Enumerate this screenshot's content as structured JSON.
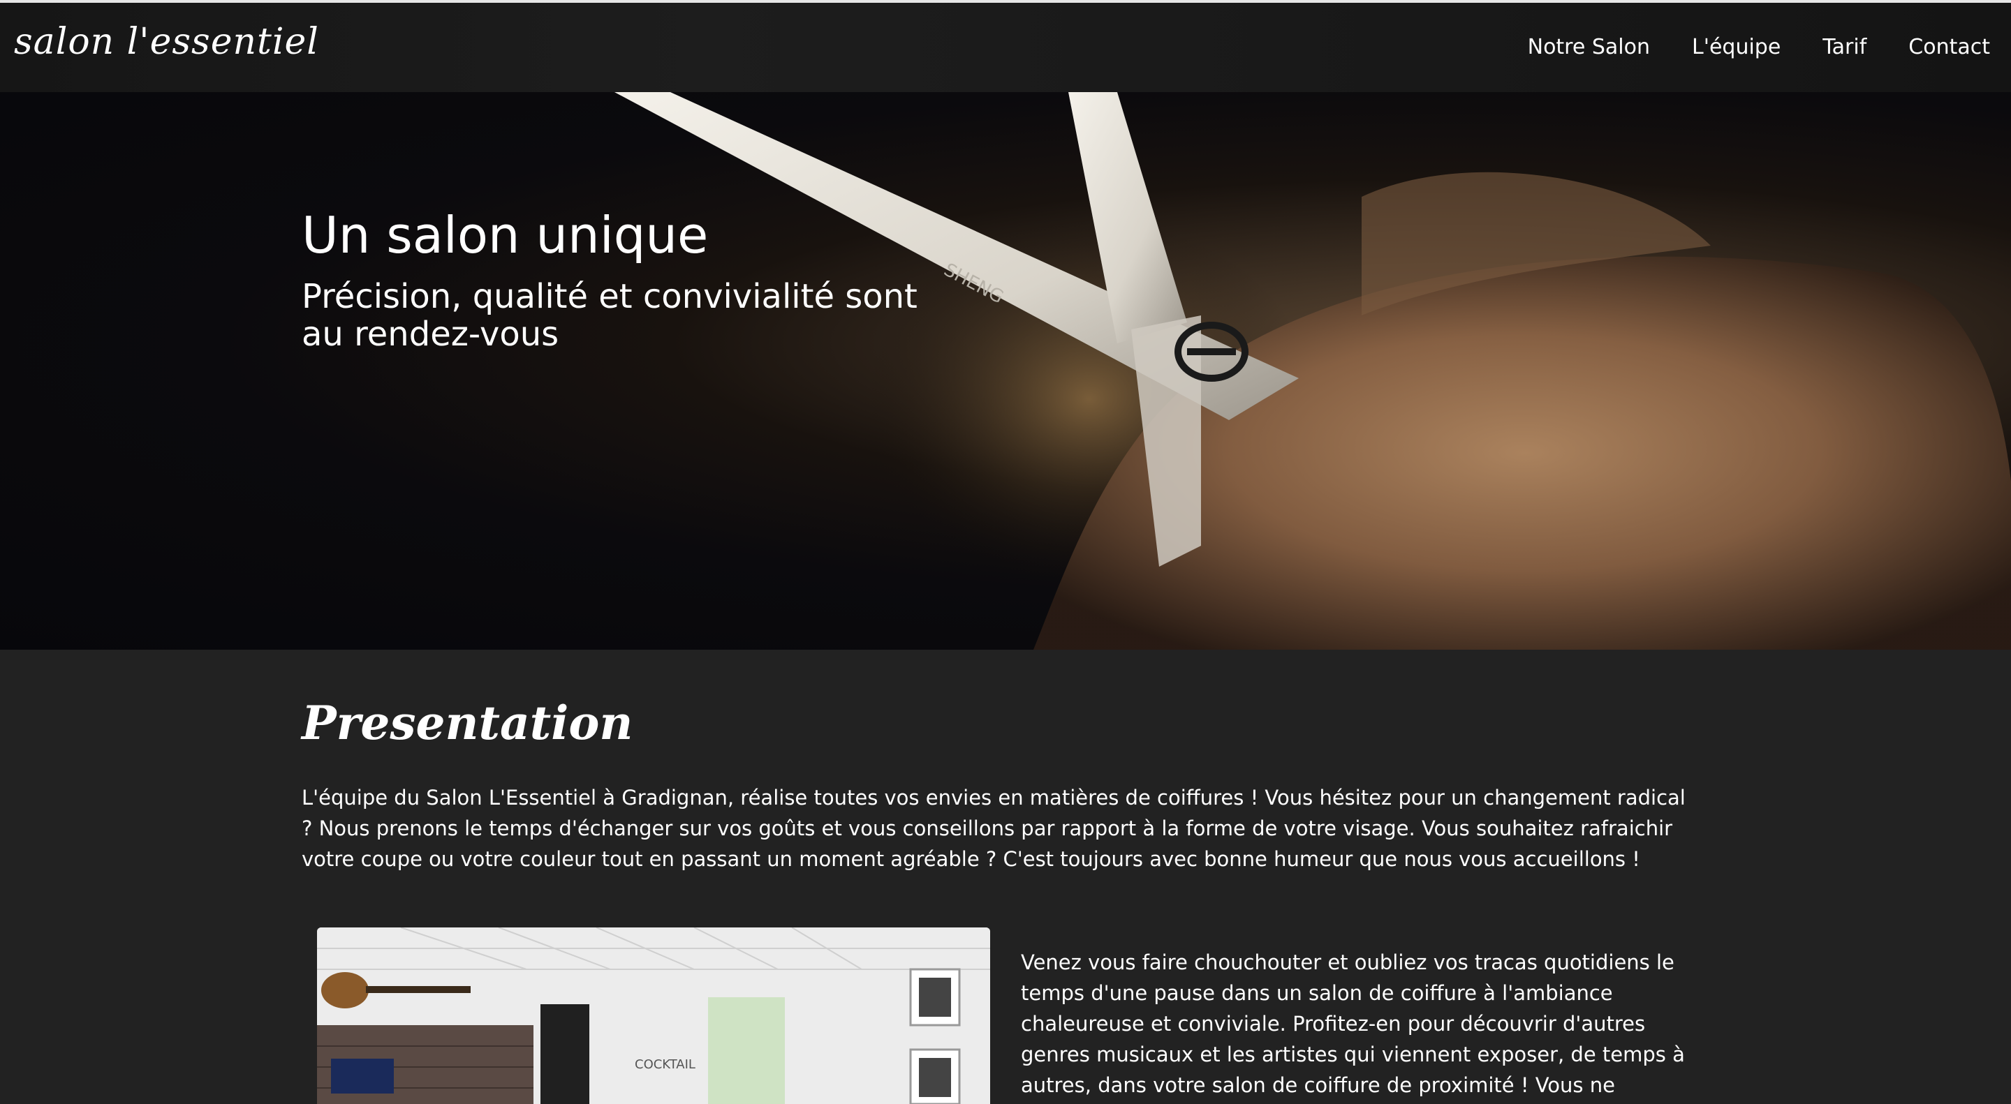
{
  "header": {
    "logo": "salon l'essentiel",
    "nav": [
      "Notre Salon",
      "L'équipe",
      "Tarif",
      "Contact"
    ]
  },
  "hero": {
    "title": "Un salon unique",
    "subtitle": "Précision, qualité et convivialité sont au rendez-vous",
    "image_text": "SHENG"
  },
  "presentation": {
    "title": "Presentation",
    "intro": "L'équipe du Salon L'Essentiel à Gradignan, réalise toutes vos envies en matières de coiffures ! Vous hésitez pour un changement radical ? Nous prenons le temps d'échanger sur vos goûts et vous conseillons par rapport à la forme de votre visage. Vous souhaitez rafraichir votre coupe ou votre couleur tout en passant un moment agréable ? C'est toujours avec bonne humeur que nous vous accueillons !",
    "side_text": "Venez vous faire chouchouter et oubliez vos tracas quotidiens le temps d'une pause dans un salon de coiffure à l'ambiance chaleureuse et conviviale. Profitez-en pour découvrir d'autres genres musicaux et les artistes qui viennent exposer, de temps à autres, dans votre salon de coiffure de proximité ! Vous ne",
    "photo_sign": "COCKTAIL"
  },
  "colors": {
    "page_bg": "#222222",
    "nav_bg": "#161616",
    "text": "#ffffff"
  }
}
